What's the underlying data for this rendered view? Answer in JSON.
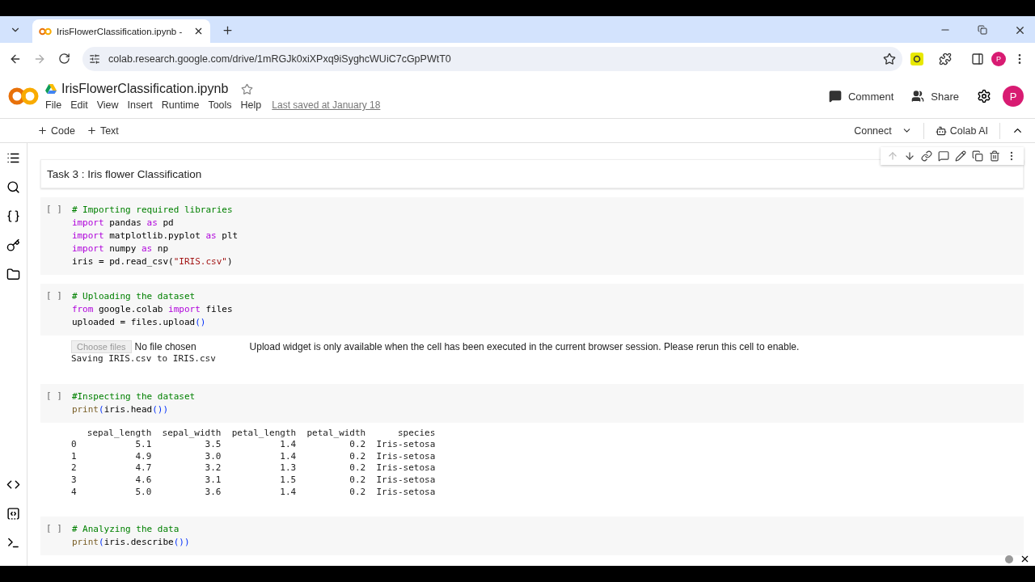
{
  "browser": {
    "tab": {
      "title": "IrisFlowerClassification.ipynb - "
    },
    "url": "colab.research.google.com/drive/1mRGJk0xiXPxq9iSyghcWUiC7cGpPWtT0",
    "avatar": "P"
  },
  "notebook": {
    "title": "IrisFlowerClassification.ipynb",
    "menu": [
      "File",
      "Edit",
      "View",
      "Insert",
      "Runtime",
      "Tools",
      "Help"
    ],
    "last_saved": "Last saved at January 18",
    "comment": "Comment",
    "share": "Share",
    "avatar": "P"
  },
  "toolbar": {
    "add_code": "Code",
    "add_text": "Text",
    "connect": "Connect",
    "colab_ai": "Colab AI"
  },
  "cells": [
    {
      "kind": "text",
      "text": "Task 3 : Iris flower Classification"
    },
    {
      "kind": "code",
      "run": "[ ]",
      "lines": [
        [
          {
            "kind": "comment",
            "text": "# Importing required libraries"
          }
        ],
        [
          {
            "kind": "keyword",
            "text": "import"
          },
          {
            "kind": "plain",
            "text": " pandas "
          },
          {
            "kind": "keyword",
            "text": "as"
          },
          {
            "kind": "plain",
            "text": " pd"
          }
        ],
        [
          {
            "kind": "keyword",
            "text": "import"
          },
          {
            "kind": "plain",
            "text": " matplotlib.pyplot "
          },
          {
            "kind": "keyword",
            "text": "as"
          },
          {
            "kind": "plain",
            "text": " plt"
          }
        ],
        [
          {
            "kind": "keyword",
            "text": "import"
          },
          {
            "kind": "plain",
            "text": " numpy "
          },
          {
            "kind": "keyword",
            "text": "as"
          },
          {
            "kind": "plain",
            "text": " np"
          }
        ],
        [
          {
            "kind": "plain",
            "text": "iris = pd.read_csv("
          },
          {
            "kind": "string",
            "text": "\"IRIS.csv\""
          },
          {
            "kind": "plain",
            "text": ")"
          }
        ]
      ]
    },
    {
      "kind": "code",
      "run": "[ ]",
      "lines": [
        [
          {
            "kind": "comment",
            "text": "# Uploading the dataset"
          }
        ],
        [
          {
            "kind": "keyword",
            "text": "from"
          },
          {
            "kind": "plain",
            "text": " google.colab "
          },
          {
            "kind": "keyword",
            "text": "import"
          },
          {
            "kind": "plain",
            "text": " files"
          }
        ],
        [
          {
            "kind": "plain",
            "text": "uploaded = files.upload"
          },
          {
            "kind": "paren",
            "text": "()"
          }
        ]
      ],
      "upload": {
        "button": "Choose files",
        "status": "No file chosen",
        "note": "Upload widget is only available when the cell has been executed in the current browser session. Please rerun this cell to enable."
      },
      "output": [
        "Saving IRIS.csv to IRIS.csv"
      ]
    },
    {
      "kind": "code",
      "run": "[ ]",
      "lines": [
        [
          {
            "kind": "comment",
            "text": "#Inspecting the dataset"
          }
        ],
        [
          {
            "kind": "func",
            "text": "print"
          },
          {
            "kind": "paren",
            "text": "("
          },
          {
            "kind": "plain",
            "text": "iris.head"
          },
          {
            "kind": "paren",
            "text": "()"
          },
          {
            "kind": "paren",
            "text": ")"
          }
        ]
      ],
      "output": [
        "   sepal_length  sepal_width  petal_length  petal_width      species",
        "0           5.1          3.5           1.4          0.2  Iris-setosa",
        "1           4.9          3.0           1.4          0.2  Iris-setosa",
        "2           4.7          3.2           1.3          0.2  Iris-setosa",
        "3           4.6          3.1           1.5          0.2  Iris-setosa",
        "4           5.0          3.6           1.4          0.2  Iris-setosa"
      ]
    },
    {
      "kind": "code",
      "run": "[ ]",
      "lines": [
        [
          {
            "kind": "comment",
            "text": "# Analyzing the data"
          }
        ],
        [
          {
            "kind": "func",
            "text": "print"
          },
          {
            "kind": "paren",
            "text": "("
          },
          {
            "kind": "plain",
            "text": "iris.describe"
          },
          {
            "kind": "paren",
            "text": "()"
          },
          {
            "kind": "paren",
            "text": ")"
          }
        ]
      ]
    }
  ]
}
